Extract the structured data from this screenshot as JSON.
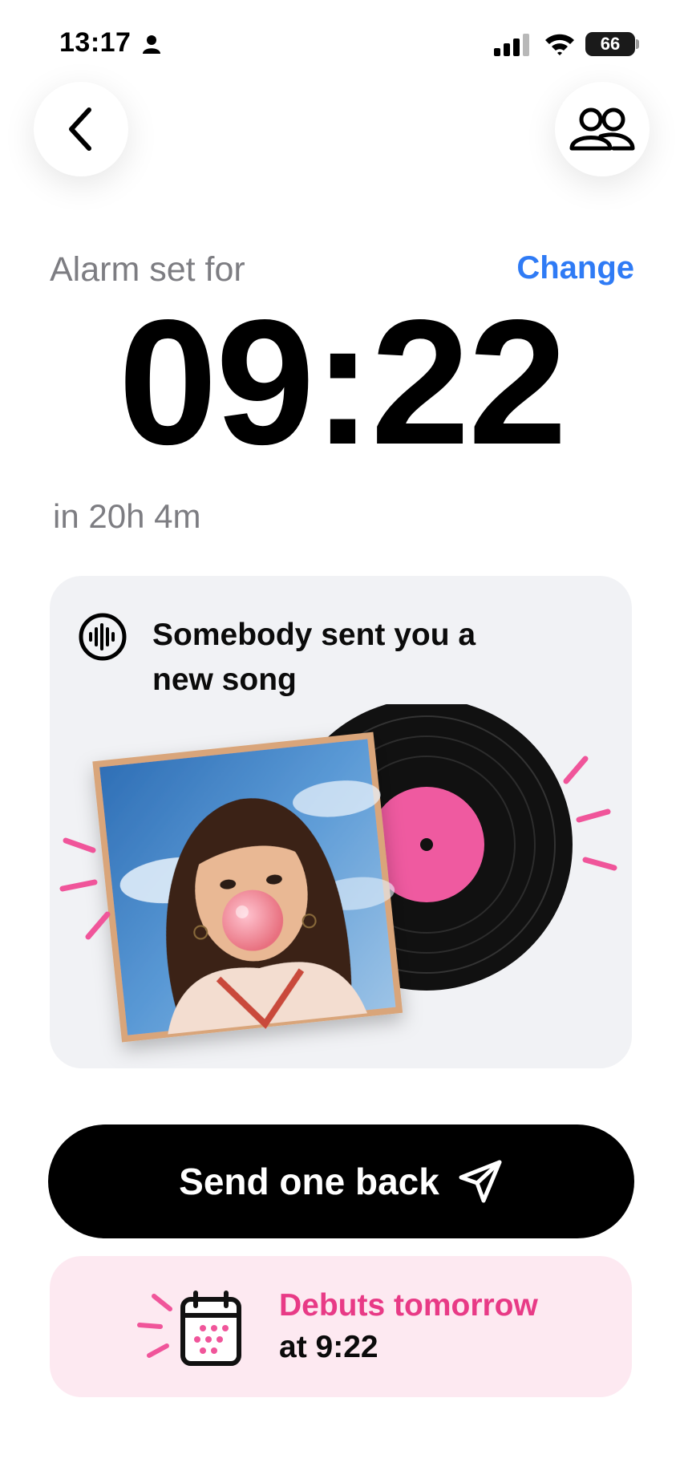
{
  "status_bar": {
    "time": "13:17",
    "battery": "66"
  },
  "header": {
    "back_icon": "chevron-left-icon",
    "friends_icon": "people-icon"
  },
  "alarm": {
    "label": "Alarm set for",
    "change_label": "Change",
    "time": "09:22",
    "countdown": "in 20h 4m"
  },
  "song_card": {
    "icon": "audio-wave-icon",
    "title": "Somebody sent you a new song"
  },
  "send_button": {
    "label": "Send one back",
    "icon": "paper-plane-icon"
  },
  "debut": {
    "icon": "calendar-icon",
    "line1": "Debuts tomorrow",
    "line2": "at 9:22"
  },
  "colors": {
    "accent_blue": "#2f7bf5",
    "accent_pink": "#e83a86",
    "card_gray": "#f1f2f5",
    "debut_bg": "#fde9f1"
  }
}
